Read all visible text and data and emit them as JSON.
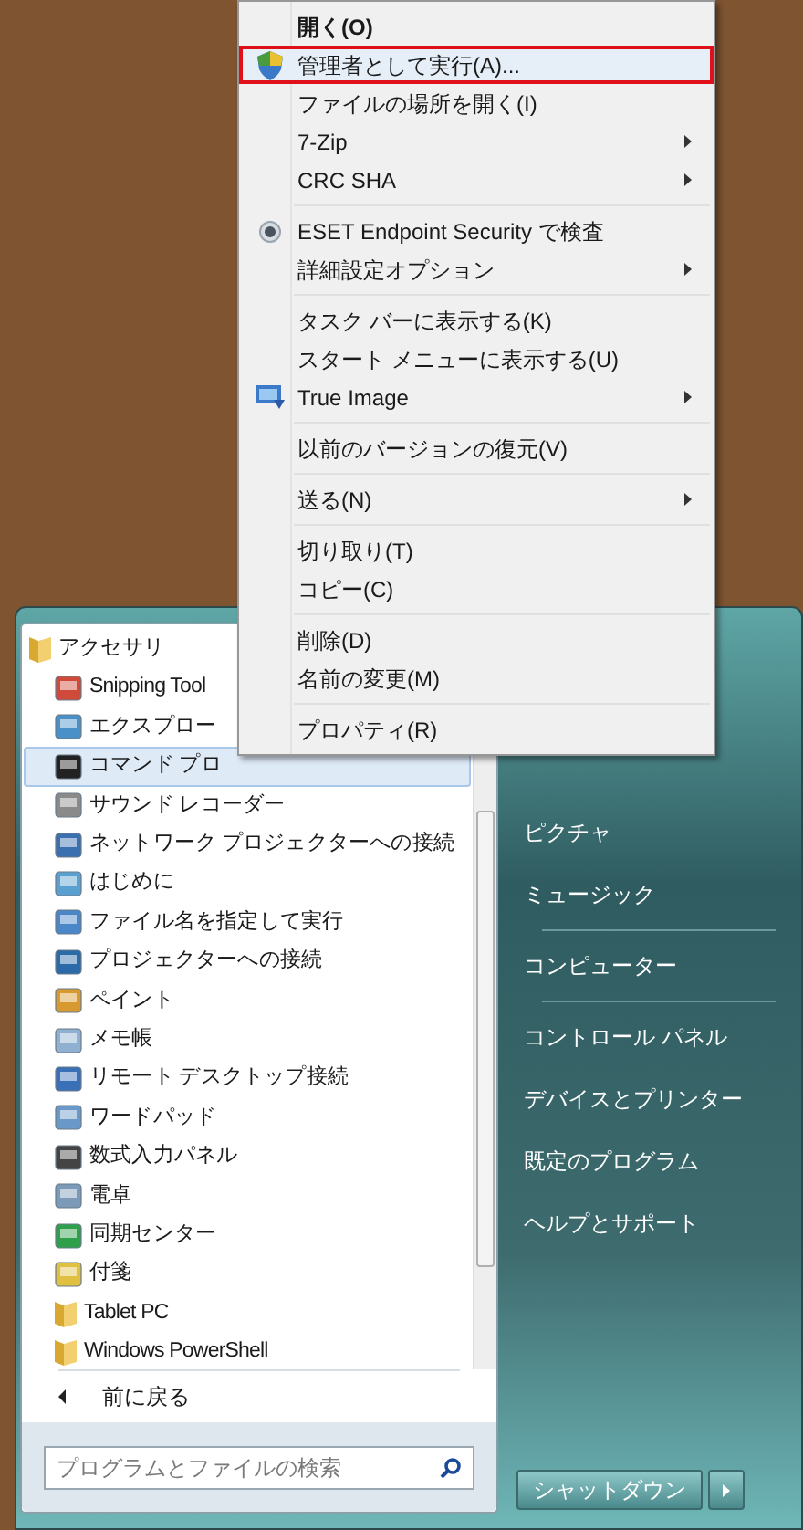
{
  "context_menu": {
    "groups": [
      [
        {
          "label": "開く(O)",
          "default": true,
          "selected": false,
          "submenu": false
        },
        {
          "label": "管理者として実行(A)...",
          "default": false,
          "selected": true,
          "submenu": false
        },
        {
          "label": "ファイルの場所を開く(I)",
          "default": false,
          "selected": false,
          "submenu": false
        },
        {
          "label": "7-Zip",
          "default": false,
          "selected": false,
          "submenu": true
        },
        {
          "label": "CRC SHA",
          "default": false,
          "selected": false,
          "submenu": true
        }
      ],
      [
        {
          "label": "ESET Endpoint Security で検査",
          "default": false,
          "selected": false,
          "submenu": false
        },
        {
          "label": "詳細設定オプション",
          "default": false,
          "selected": false,
          "submenu": true
        }
      ],
      [
        {
          "label": "タスク バーに表示する(K)",
          "default": false,
          "selected": false,
          "submenu": false
        },
        {
          "label": "スタート メニューに表示する(U)",
          "default": false,
          "selected": false,
          "submenu": false
        },
        {
          "label": "True Image",
          "default": false,
          "selected": false,
          "submenu": true
        }
      ],
      [
        {
          "label": "以前のバージョンの復元(V)",
          "default": false,
          "selected": false,
          "submenu": false
        }
      ],
      [
        {
          "label": "送る(N)",
          "default": false,
          "selected": false,
          "submenu": true
        }
      ],
      [
        {
          "label": "切り取り(T)",
          "default": false,
          "selected": false,
          "submenu": false
        },
        {
          "label": "コピー(C)",
          "default": false,
          "selected": false,
          "submenu": false
        }
      ],
      [
        {
          "label": "削除(D)",
          "default": false,
          "selected": false,
          "submenu": false
        },
        {
          "label": "名前の変更(M)",
          "default": false,
          "selected": false,
          "submenu": false
        }
      ],
      [
        {
          "label": "プロパティ(R)",
          "default": false,
          "selected": false,
          "submenu": false
        }
      ]
    ]
  },
  "programs": [
    {
      "label": "アクセサリ",
      "kind": "folder",
      "selected": false,
      "children": [
        {
          "label": "Snipping Tool",
          "kind": "app",
          "selected": false
        },
        {
          "label": "エクスプロー",
          "kind": "app",
          "selected": false
        },
        {
          "label": "コマンド プロ",
          "kind": "app",
          "selected": true
        },
        {
          "label": "サウンド レコーダー",
          "kind": "app",
          "selected": false
        },
        {
          "label": "ネットワーク プロジェクターへの接続",
          "kind": "app",
          "selected": false
        },
        {
          "label": "はじめに",
          "kind": "app",
          "selected": false
        },
        {
          "label": "ファイル名を指定して実行",
          "kind": "app",
          "selected": false
        },
        {
          "label": "プロジェクターへの接続",
          "kind": "app",
          "selected": false
        },
        {
          "label": "ペイント",
          "kind": "app",
          "selected": false
        },
        {
          "label": "メモ帳",
          "kind": "app",
          "selected": false
        },
        {
          "label": "リモート デスクトップ接続",
          "kind": "app",
          "selected": false
        },
        {
          "label": "ワードパッド",
          "kind": "app",
          "selected": false
        },
        {
          "label": "数式入力パネル",
          "kind": "app",
          "selected": false
        },
        {
          "label": "電卓",
          "kind": "app",
          "selected": false
        },
        {
          "label": "同期センター",
          "kind": "app",
          "selected": false
        },
        {
          "label": "付箋",
          "kind": "app",
          "selected": false
        },
        {
          "label": "Tablet PC",
          "kind": "folder",
          "selected": false
        },
        {
          "label": "Windows PowerShell",
          "kind": "folder",
          "selected": false
        }
      ]
    }
  ],
  "back": {
    "label": "前に戻る"
  },
  "search": {
    "placeholder": "プログラムとファイルの検索"
  },
  "places": [
    [
      {
        "label": "ピクチャ"
      },
      {
        "label": "ミュージック"
      }
    ],
    [
      {
        "label": "コンピューター"
      }
    ],
    [
      {
        "label": "コントロール パネル"
      },
      {
        "label": "デバイスとプリンター"
      },
      {
        "label": "既定のプログラム"
      },
      {
        "label": "ヘルプとサポート"
      }
    ]
  ],
  "shutdown": {
    "label": "シャットダウン"
  }
}
